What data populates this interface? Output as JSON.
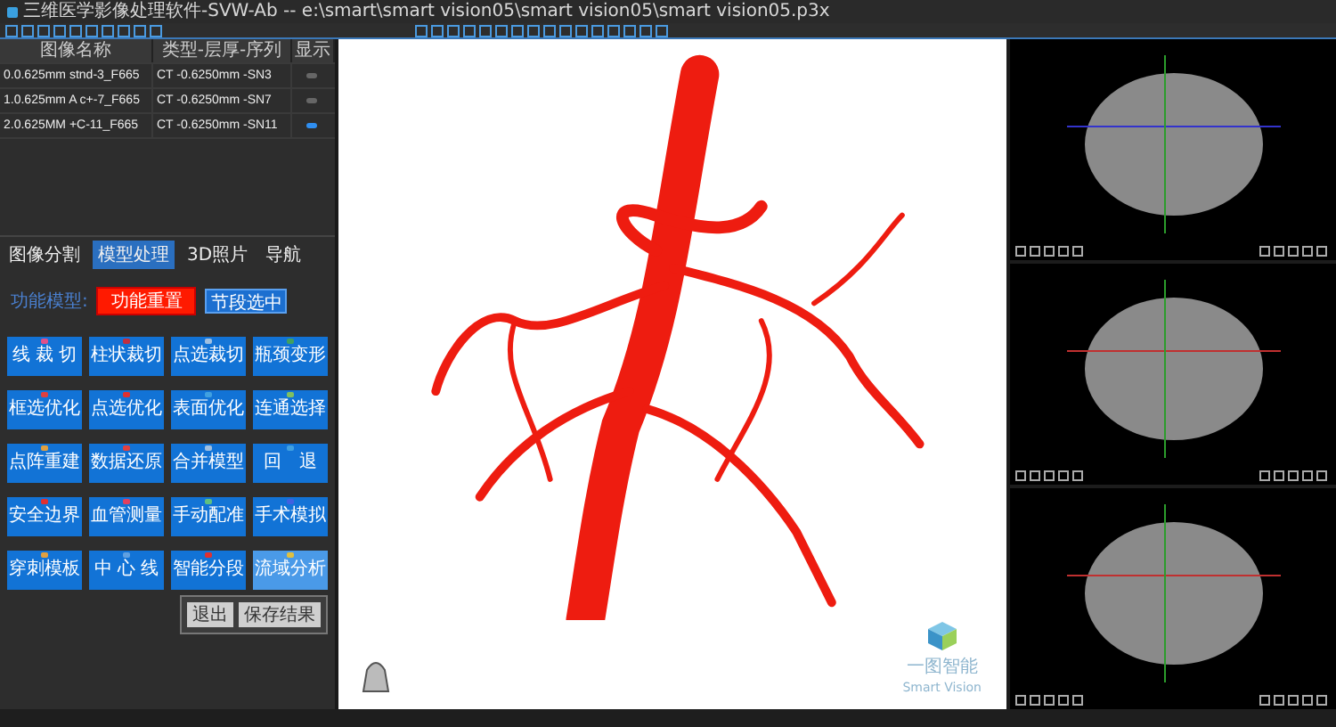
{
  "window": {
    "title": "三维医学影像处理软件-SVW-Ab -- e:\\smart\\smart vision05\\smart vision05\\smart vision05.p3x"
  },
  "series_table": {
    "columns": [
      "图像名称",
      "类型-层厚-序列",
      "显示"
    ],
    "rows": [
      {
        "name": "0.0.625mm stnd-3_F665",
        "type": "CT -0.6250mm -SN3",
        "visible": false
      },
      {
        "name": "1.0.625mm A c+-7_F665",
        "type": "CT -0.6250mm -SN7",
        "visible": false
      },
      {
        "name": "2.0.625MM +C-11_F665",
        "type": "CT -0.6250mm -SN11",
        "visible": true
      }
    ]
  },
  "tabs": [
    {
      "label": "图像分割",
      "selected": false
    },
    {
      "label": "模型处理",
      "selected": true
    },
    {
      "label": "3D照片",
      "selected": false
    },
    {
      "label": "导航",
      "selected": false
    }
  ],
  "function_bar": {
    "label": "功能模型:",
    "primary": "功能重置",
    "secondary": "节段选中"
  },
  "tools": [
    {
      "label": "线 裁 切",
      "color": "#e0508a",
      "active": false
    },
    {
      "label": "柱状裁切",
      "color": "#c03040",
      "active": false
    },
    {
      "label": "点选裁切",
      "color": "#a0c0e0",
      "active": false
    },
    {
      "label": "瓶颈变形",
      "color": "#40a060",
      "active": false
    },
    {
      "label": "框选优化",
      "color": "#e04040",
      "active": false
    },
    {
      "label": "点选优化",
      "color": "#e03030",
      "active": false
    },
    {
      "label": "表面优化",
      "color": "#40a0e0",
      "active": false
    },
    {
      "label": "连通选择",
      "color": "#80c060",
      "active": false
    },
    {
      "label": "点阵重建",
      "color": "#e0a040",
      "active": false
    },
    {
      "label": "数据还原",
      "color": "#e04040",
      "active": false
    },
    {
      "label": "合并模型",
      "color": "#a0c0e0",
      "active": false
    },
    {
      "label": "回　退",
      "color": "#40a0e0",
      "active": false
    },
    {
      "label": "安全边界",
      "color": "#e03030",
      "active": false
    },
    {
      "label": "血管测量",
      "color": "#e04060",
      "active": false
    },
    {
      "label": "手动配准",
      "color": "#60c080",
      "active": false
    },
    {
      "label": "手术模拟",
      "color": "#4060e0",
      "active": false
    },
    {
      "label": "穿刺模板",
      "color": "#e0a040",
      "active": false
    },
    {
      "label": "中 心 线",
      "color": "#60a0e0",
      "active": false
    },
    {
      "label": "智能分段",
      "color": "#e03030",
      "active": false
    },
    {
      "label": "流域分析",
      "color": "#e0c040",
      "active": true
    }
  ],
  "popup": {
    "buttons": [
      "退出",
      "保存结果"
    ]
  },
  "viewport": {
    "logo_cn": "一图智能",
    "logo_en": "Smart Vision"
  }
}
